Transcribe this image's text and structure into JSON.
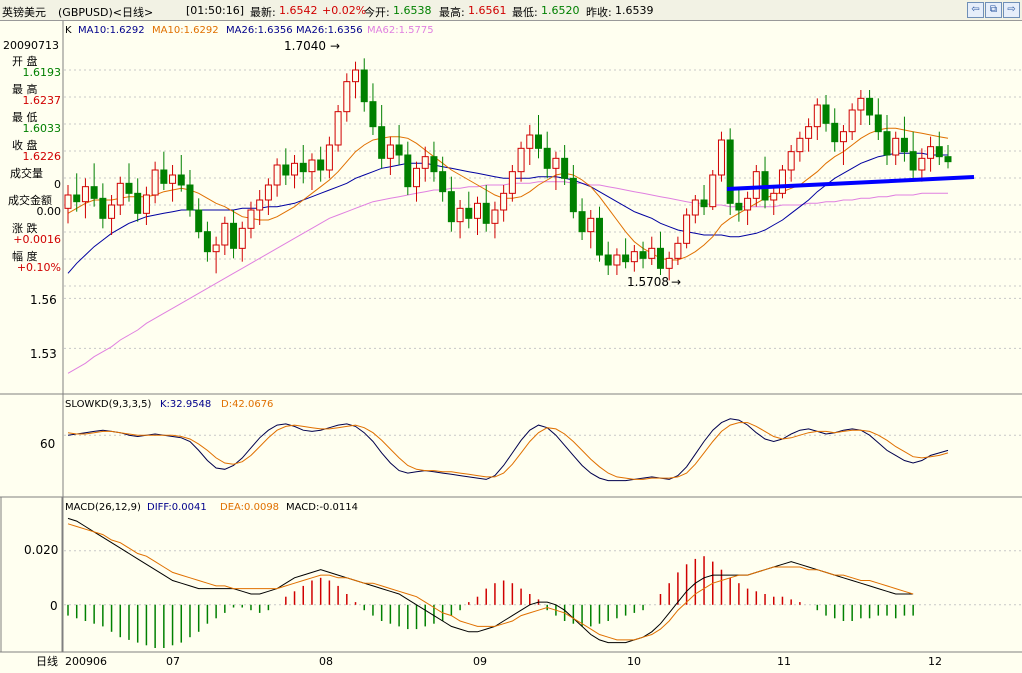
{
  "titlebar": {
    "name": "英镑美元",
    "code": "(GBPUSD)<日线>",
    "time": "[01:50:16]",
    "latest_label": "最新:",
    "latest_value": "1.6542",
    "change": "+0.02%",
    "open_label": "今开:",
    "open_value": "1.6538",
    "high_label": "最高:",
    "high_value": "1.6561",
    "low_label": "最低:",
    "low_value": "1.6520",
    "prev_label": "昨收:",
    "prev_value": "1.6539"
  },
  "info": {
    "date": "20090713",
    "open_label": "开  盘",
    "open_value": "1.6193",
    "high_label": "最  高",
    "high_value": "1.6237",
    "low_label": "最  低",
    "low_value": "1.6033",
    "close_label": "收  盘",
    "close_value": "1.6226",
    "volume_label": "成交量",
    "volume_value": "0",
    "amount_label": "成交金额",
    "amount_value": "0.00",
    "change_label": "涨  跌",
    "change_value": "+0.0016",
    "pct_label": "幅  度",
    "pct_value": "+0.10%"
  },
  "price_legend": {
    "k": "K",
    "ma10a": "MA10:1.6292",
    "ma10b": "MA10:1.6292",
    "ma26a": "MA26:1.6356",
    "ma26b": "MA26:1.6356",
    "ma62": "MA62:1.5775"
  },
  "kd_legend": {
    "name": "SLOWKD(9,3,3,5)",
    "k": "K:32.9548",
    "d": "D:42.0676"
  },
  "macd_legend": {
    "name": "MACD(26,12,9)",
    "diff": "DIFF:0.0041",
    "dea": "DEA:0.0098",
    "macd": "MACD:-0.0114"
  },
  "axis": {
    "price_ticks": [
      "1.56",
      "1.53"
    ],
    "kd_ticks": [
      "60"
    ],
    "macd_ticks": [
      "0.020",
      "0"
    ],
    "x_label": "日线",
    "x_ticks": [
      "200906",
      "07",
      "08",
      "09",
      "10",
      "11",
      "12"
    ]
  },
  "annotations": {
    "high": "1.7040",
    "low": "1.5708"
  },
  "colors": {
    "up": "#d00000",
    "down": "#008000",
    "ma10": "#e07000",
    "ma26": "#0000a0",
    "ma62": "#e080e0",
    "trend": "#0000ff",
    "kd_k": "#00004d",
    "kd_d": "#e07000",
    "macd_diff": "#000000",
    "macd_dea": "#e07000",
    "background": "#fffff0"
  },
  "chart_data": {
    "type": "candlestick",
    "high_mark": 1.704,
    "low_mark": 1.5708,
    "candles": [
      [
        1.614,
        1.628,
        1.605,
        1.622
      ],
      [
        1.622,
        1.635,
        1.612,
        1.618
      ],
      [
        1.618,
        1.632,
        1.608,
        1.627
      ],
      [
        1.627,
        1.641,
        1.615,
        1.62
      ],
      [
        1.62,
        1.629,
        1.602,
        1.608
      ],
      [
        1.608,
        1.622,
        1.598,
        1.616
      ],
      [
        1.616,
        1.633,
        1.61,
        1.629
      ],
      [
        1.629,
        1.641,
        1.618,
        1.623
      ],
      [
        1.623,
        1.632,
        1.606,
        1.611
      ],
      [
        1.611,
        1.627,
        1.604,
        1.622
      ],
      [
        1.622,
        1.642,
        1.617,
        1.637
      ],
      [
        1.637,
        1.648,
        1.625,
        1.629
      ],
      [
        1.629,
        1.64,
        1.618,
        1.634
      ],
      [
        1.634,
        1.646,
        1.624,
        1.628
      ],
      [
        1.628,
        1.637,
        1.609,
        1.613
      ],
      [
        1.613,
        1.62,
        1.596,
        1.6
      ],
      [
        1.6,
        1.606,
        1.582,
        1.588
      ],
      [
        1.588,
        1.597,
        1.575,
        1.592
      ],
      [
        1.592,
        1.609,
        1.586,
        1.605
      ],
      [
        1.605,
        1.613,
        1.584,
        1.59
      ],
      [
        1.59,
        1.606,
        1.582,
        1.602
      ],
      [
        1.602,
        1.618,
        1.596,
        1.613
      ],
      [
        1.613,
        1.625,
        1.604,
        1.619
      ],
      [
        1.619,
        1.632,
        1.61,
        1.628
      ],
      [
        1.628,
        1.644,
        1.621,
        1.64
      ],
      [
        1.64,
        1.65,
        1.628,
        1.634
      ],
      [
        1.634,
        1.646,
        1.626,
        1.641
      ],
      [
        1.641,
        1.652,
        1.629,
        1.636
      ],
      [
        1.636,
        1.647,
        1.625,
        1.643
      ],
      [
        1.643,
        1.651,
        1.63,
        1.637
      ],
      [
        1.637,
        1.657,
        1.632,
        1.652
      ],
      [
        1.652,
        1.676,
        1.648,
        1.672
      ],
      [
        1.672,
        1.695,
        1.666,
        1.69
      ],
      [
        1.69,
        1.702,
        1.68,
        1.697
      ],
      [
        1.697,
        1.704,
        1.672,
        1.678
      ],
      [
        1.678,
        1.689,
        1.658,
        1.663
      ],
      [
        1.663,
        1.676,
        1.638,
        1.644
      ],
      [
        1.644,
        1.657,
        1.634,
        1.652
      ],
      [
        1.652,
        1.664,
        1.64,
        1.646
      ],
      [
        1.646,
        1.654,
        1.622,
        1.627
      ],
      [
        1.627,
        1.642,
        1.618,
        1.638
      ],
      [
        1.638,
        1.651,
        1.63,
        1.645
      ],
      [
        1.645,
        1.654,
        1.63,
        1.636
      ],
      [
        1.636,
        1.645,
        1.618,
        1.624
      ],
      [
        1.624,
        1.633,
        1.6,
        1.606
      ],
      [
        1.606,
        1.619,
        1.596,
        1.614
      ],
      [
        1.614,
        1.624,
        1.602,
        1.608
      ],
      [
        1.608,
        1.621,
        1.598,
        1.617
      ],
      [
        1.617,
        1.628,
        1.6,
        1.605
      ],
      [
        1.605,
        1.618,
        1.596,
        1.613
      ],
      [
        1.613,
        1.628,
        1.606,
        1.623
      ],
      [
        1.623,
        1.64,
        1.618,
        1.636
      ],
      [
        1.636,
        1.654,
        1.63,
        1.65
      ],
      [
        1.65,
        1.664,
        1.64,
        1.658
      ],
      [
        1.658,
        1.67,
        1.644,
        1.65
      ],
      [
        1.65,
        1.66,
        1.632,
        1.638
      ],
      [
        1.638,
        1.648,
        1.625,
        1.644
      ],
      [
        1.644,
        1.652,
        1.628,
        1.632
      ],
      [
        1.632,
        1.64,
        1.608,
        1.612
      ],
      [
        1.612,
        1.62,
        1.595,
        1.6
      ],
      [
        1.6,
        1.613,
        1.59,
        1.608
      ],
      [
        1.608,
        1.615,
        1.582,
        1.586
      ],
      [
        1.586,
        1.594,
        1.574,
        1.58
      ],
      [
        1.58,
        1.59,
        1.574,
        1.586
      ],
      [
        1.586,
        1.596,
        1.578,
        1.582
      ],
      [
        1.582,
        1.592,
        1.576,
        1.588
      ],
      [
        1.588,
        1.594,
        1.578,
        1.584
      ],
      [
        1.584,
        1.597,
        1.58,
        1.59
      ],
      [
        1.59,
        1.6,
        1.574,
        1.578
      ],
      [
        1.578,
        1.588,
        1.5708,
        1.584
      ],
      [
        1.584,
        1.597,
        1.58,
        1.593
      ],
      [
        1.593,
        1.614,
        1.59,
        1.61
      ],
      [
        1.61,
        1.622,
        1.605,
        1.619
      ],
      [
        1.619,
        1.628,
        1.61,
        1.615
      ],
      [
        1.615,
        1.637,
        1.613,
        1.634
      ],
      [
        1.634,
        1.66,
        1.63,
        1.655
      ],
      [
        1.655,
        1.662,
        1.61,
        1.617
      ],
      [
        1.617,
        1.625,
        1.606,
        1.613
      ],
      [
        1.613,
        1.624,
        1.604,
        1.62
      ],
      [
        1.62,
        1.64,
        1.615,
        1.636
      ],
      [
        1.636,
        1.645,
        1.614,
        1.619
      ],
      [
        1.619,
        1.628,
        1.61,
        1.623
      ],
      [
        1.623,
        1.64,
        1.62,
        1.637
      ],
      [
        1.637,
        1.652,
        1.63,
        1.648
      ],
      [
        1.648,
        1.66,
        1.642,
        1.656
      ],
      [
        1.656,
        1.668,
        1.648,
        1.663
      ],
      [
        1.663,
        1.68,
        1.655,
        1.676
      ],
      [
        1.676,
        1.682,
        1.66,
        1.665
      ],
      [
        1.665,
        1.674,
        1.648,
        1.654
      ],
      [
        1.654,
        1.664,
        1.64,
        1.66
      ],
      [
        1.66,
        1.677,
        1.655,
        1.673
      ],
      [
        1.673,
        1.685,
        1.664,
        1.68
      ],
      [
        1.68,
        1.685,
        1.664,
        1.67
      ],
      [
        1.67,
        1.68,
        1.655,
        1.66
      ],
      [
        1.66,
        1.67,
        1.64,
        1.646
      ],
      [
        1.646,
        1.66,
        1.64,
        1.656
      ],
      [
        1.656,
        1.669,
        1.642,
        1.648
      ],
      [
        1.648,
        1.66,
        1.63,
        1.637
      ],
      [
        1.637,
        1.65,
        1.63,
        1.644
      ],
      [
        1.644,
        1.657,
        1.636,
        1.651
      ],
      [
        1.651,
        1.66,
        1.64,
        1.645
      ],
      [
        1.645,
        1.652,
        1.638,
        1.642
      ]
    ],
    "ma10": [
      1.611,
      1.614,
      1.617,
      1.619,
      1.619,
      1.619,
      1.62,
      1.621,
      1.621,
      1.621,
      1.622,
      1.624,
      1.625,
      1.626,
      1.625,
      1.623,
      1.62,
      1.617,
      1.615,
      1.612,
      1.609,
      1.608,
      1.607,
      1.607,
      1.609,
      1.612,
      1.615,
      1.619,
      1.623,
      1.627,
      1.631,
      1.636,
      1.642,
      1.648,
      1.652,
      1.655,
      1.656,
      1.657,
      1.657,
      1.656,
      1.653,
      1.649,
      1.645,
      1.641,
      1.637,
      1.634,
      1.631,
      1.628,
      1.625,
      1.622,
      1.62,
      1.62,
      1.621,
      1.624,
      1.628,
      1.631,
      1.634,
      1.635,
      1.634,
      1.631,
      1.627,
      1.621,
      1.614,
      1.607,
      1.6,
      1.594,
      1.59,
      1.587,
      1.584,
      1.583,
      1.583,
      1.585,
      1.588,
      1.592,
      1.597,
      1.604,
      1.608,
      1.611,
      1.614,
      1.617,
      1.62,
      1.622,
      1.624,
      1.626,
      1.628,
      1.632,
      1.636,
      1.641,
      1.645,
      1.648,
      1.652,
      1.656,
      1.659,
      1.661,
      1.662,
      1.662,
      1.661,
      1.66,
      1.659,
      1.658,
      1.657,
      1.656
    ],
    "ma26": [
      1.575,
      1.581,
      1.586,
      1.591,
      1.595,
      1.599,
      1.602,
      1.605,
      1.607,
      1.609,
      1.61,
      1.611,
      1.612,
      1.613,
      1.613,
      1.613,
      1.613,
      1.613,
      1.613,
      1.613,
      1.614,
      1.614,
      1.614,
      1.615,
      1.615,
      1.616,
      1.617,
      1.619,
      1.621,
      1.623,
      1.625,
      1.627,
      1.629,
      1.632,
      1.634,
      1.636,
      1.638,
      1.639,
      1.64,
      1.641,
      1.641,
      1.641,
      1.64,
      1.639,
      1.638,
      1.637,
      1.636,
      1.635,
      1.634,
      1.633,
      1.632,
      1.632,
      1.632,
      1.632,
      1.633,
      1.633,
      1.633,
      1.632,
      1.631,
      1.629,
      1.627,
      1.624,
      1.621,
      1.618,
      1.615,
      1.612,
      1.61,
      1.608,
      1.605,
      1.603,
      1.601,
      1.6,
      1.599,
      1.598,
      1.598,
      1.598,
      1.597,
      1.597,
      1.598,
      1.599,
      1.601,
      1.604,
      1.607,
      1.611,
      1.615,
      1.619,
      1.624,
      1.628,
      1.632,
      1.635,
      1.638,
      1.641,
      1.643,
      1.645,
      1.646,
      1.647,
      1.647,
      1.647,
      1.647,
      1.646,
      1.646,
      1.646
    ],
    "ma62": [
      1.515,
      1.518,
      1.521,
      1.525,
      1.528,
      1.531,
      1.535,
      1.538,
      1.541,
      1.545,
      1.548,
      1.551,
      1.554,
      1.557,
      1.56,
      1.563,
      1.566,
      1.569,
      1.572,
      1.575,
      1.578,
      1.581,
      1.584,
      1.587,
      1.59,
      1.593,
      1.596,
      1.599,
      1.602,
      1.605,
      1.608,
      1.61,
      1.612,
      1.614,
      1.616,
      1.618,
      1.619,
      1.62,
      1.621,
      1.622,
      1.623,
      1.624,
      1.625,
      1.625,
      1.626,
      1.626,
      1.627,
      1.627,
      1.628,
      1.628,
      1.628,
      1.629,
      1.629,
      1.629,
      1.63,
      1.63,
      1.63,
      1.63,
      1.629,
      1.629,
      1.628,
      1.628,
      1.627,
      1.626,
      1.625,
      1.624,
      1.623,
      1.622,
      1.621,
      1.62,
      1.619,
      1.618,
      1.617,
      1.617,
      1.616,
      1.616,
      1.615,
      1.615,
      1.615,
      1.615,
      1.615,
      1.615,
      1.616,
      1.616,
      1.616,
      1.617,
      1.617,
      1.618,
      1.618,
      1.619,
      1.619,
      1.62,
      1.62,
      1.621,
      1.621,
      1.622,
      1.622,
      1.622,
      1.623,
      1.623,
      1.623,
      1.623
    ],
    "kd_k": [
      60,
      61,
      62,
      63,
      64,
      63,
      62,
      60,
      59,
      60,
      61,
      60,
      59,
      58,
      55,
      48,
      40,
      34,
      33,
      36,
      42,
      50,
      58,
      64,
      68,
      69,
      67,
      64,
      63,
      64,
      66,
      68,
      69,
      67,
      62,
      55,
      46,
      38,
      32,
      30,
      31,
      32,
      31,
      30,
      29,
      28,
      27,
      26,
      25,
      28,
      36,
      46,
      56,
      64,
      68,
      66,
      60,
      52,
      44,
      36,
      30,
      26,
      24,
      24,
      24,
      25,
      26,
      27,
      26,
      25,
      28,
      35,
      45,
      55,
      64,
      70,
      73,
      72,
      68,
      62,
      57,
      55,
      57,
      61,
      64,
      65,
      63,
      61,
      62,
      64,
      65,
      64,
      60,
      54,
      48,
      44,
      40,
      38,
      40,
      44,
      46,
      48
    ],
    "kd_d": [
      62,
      61,
      61,
      62,
      63,
      63,
      62,
      61,
      60,
      60,
      60,
      60,
      60,
      59,
      57,
      53,
      48,
      42,
      38,
      37,
      39,
      44,
      51,
      58,
      64,
      67,
      68,
      67,
      66,
      65,
      65,
      66,
      67,
      68,
      66,
      62,
      56,
      49,
      42,
      36,
      33,
      32,
      32,
      31,
      31,
      30,
      29,
      28,
      27,
      27,
      30,
      37,
      46,
      55,
      62,
      66,
      65,
      61,
      55,
      48,
      41,
      35,
      30,
      27,
      26,
      25,
      25,
      26,
      26,
      26,
      27,
      30,
      37,
      46,
      55,
      63,
      68,
      70,
      70,
      67,
      63,
      59,
      57,
      58,
      60,
      62,
      63,
      63,
      62,
      63,
      64,
      64,
      63,
      60,
      56,
      51,
      47,
      43,
      42,
      43,
      44,
      46
    ],
    "macd_diff": [
      0.032,
      0.031,
      0.029,
      0.027,
      0.025,
      0.023,
      0.021,
      0.019,
      0.017,
      0.015,
      0.013,
      0.011,
      0.009,
      0.008,
      0.007,
      0.006,
      0.006,
      0.006,
      0.006,
      0.006,
      0.005,
      0.004,
      0.004,
      0.005,
      0.006,
      0.008,
      0.01,
      0.011,
      0.012,
      0.013,
      0.012,
      0.011,
      0.01,
      0.009,
      0.008,
      0.007,
      0.006,
      0.005,
      0.004,
      0.002,
      0.0,
      -0.002,
      -0.004,
      -0.006,
      -0.008,
      -0.009,
      -0.01,
      -0.01,
      -0.009,
      -0.008,
      -0.006,
      -0.004,
      -0.002,
      0.0,
      0.001,
      0.001,
      0.0,
      -0.002,
      -0.005,
      -0.008,
      -0.011,
      -0.013,
      -0.014,
      -0.014,
      -0.014,
      -0.013,
      -0.012,
      -0.01,
      -0.007,
      -0.003,
      0.001,
      0.005,
      0.008,
      0.01,
      0.011,
      0.011,
      0.011,
      0.011,
      0.011,
      0.012,
      0.013,
      0.014,
      0.015,
      0.016,
      0.015,
      0.014,
      0.013,
      0.012,
      0.011,
      0.01,
      0.009,
      0.008,
      0.007,
      0.006,
      0.005,
      0.004,
      0.004,
      0.004
    ],
    "macd_dea": [
      0.03,
      0.029,
      0.028,
      0.027,
      0.026,
      0.024,
      0.023,
      0.021,
      0.019,
      0.018,
      0.016,
      0.014,
      0.012,
      0.011,
      0.01,
      0.009,
      0.008,
      0.007,
      0.007,
      0.006,
      0.006,
      0.006,
      0.006,
      0.006,
      0.006,
      0.007,
      0.008,
      0.009,
      0.01,
      0.011,
      0.011,
      0.01,
      0.01,
      0.009,
      0.008,
      0.008,
      0.007,
      0.006,
      0.005,
      0.004,
      0.003,
      0.001,
      -0.001,
      -0.003,
      -0.004,
      -0.006,
      -0.007,
      -0.008,
      -0.008,
      -0.008,
      -0.007,
      -0.006,
      -0.004,
      -0.003,
      -0.002,
      -0.001,
      -0.002,
      -0.003,
      -0.005,
      -0.007,
      -0.009,
      -0.011,
      -0.012,
      -0.013,
      -0.013,
      -0.013,
      -0.012,
      -0.011,
      -0.009,
      -0.006,
      -0.002,
      0.001,
      0.004,
      0.006,
      0.008,
      0.009,
      0.01,
      0.011,
      0.011,
      0.012,
      0.013,
      0.014,
      0.014,
      0.014,
      0.014,
      0.013,
      0.013,
      0.012,
      0.011,
      0.011,
      0.01,
      0.009,
      0.009,
      0.008,
      0.007,
      0.006,
      0.005,
      0.004
    ],
    "macd_hist": [
      -0.004,
      -0.005,
      -0.006,
      -0.007,
      -0.008,
      -0.01,
      -0.012,
      -0.013,
      -0.014,
      -0.015,
      -0.016,
      -0.016,
      -0.015,
      -0.014,
      -0.012,
      -0.01,
      -0.007,
      -0.005,
      -0.003,
      -0.001,
      -0.001,
      -0.002,
      -0.003,
      -0.002,
      0.0,
      0.003,
      0.005,
      0.007,
      0.009,
      0.01,
      0.009,
      0.007,
      0.004,
      0.001,
      -0.002,
      -0.004,
      -0.006,
      -0.007,
      -0.008,
      -0.009,
      -0.009,
      -0.008,
      -0.007,
      -0.006,
      -0.004,
      -0.002,
      0.001,
      0.003,
      0.006,
      0.008,
      0.009,
      0.008,
      0.006,
      0.004,
      0.002,
      -0.002,
      -0.004,
      -0.006,
      -0.007,
      -0.008,
      -0.008,
      -0.007,
      -0.006,
      -0.005,
      -0.004,
      -0.003,
      -0.002,
      0.0,
      0.004,
      0.008,
      0.012,
      0.015,
      0.017,
      0.018,
      0.016,
      0.013,
      0.01,
      0.008,
      0.006,
      0.005,
      0.004,
      0.003,
      0.003,
      0.002,
      0.001,
      0.0,
      -0.002,
      -0.004,
      -0.005,
      -0.006,
      -0.006,
      -0.005,
      -0.005,
      -0.004,
      -0.004,
      -0.005,
      -0.004,
      -0.004
    ],
    "price_range": [
      1.505,
      1.715
    ],
    "kd_range": [
      15,
      80
    ],
    "macd_range": [
      -0.016,
      0.034
    ]
  }
}
